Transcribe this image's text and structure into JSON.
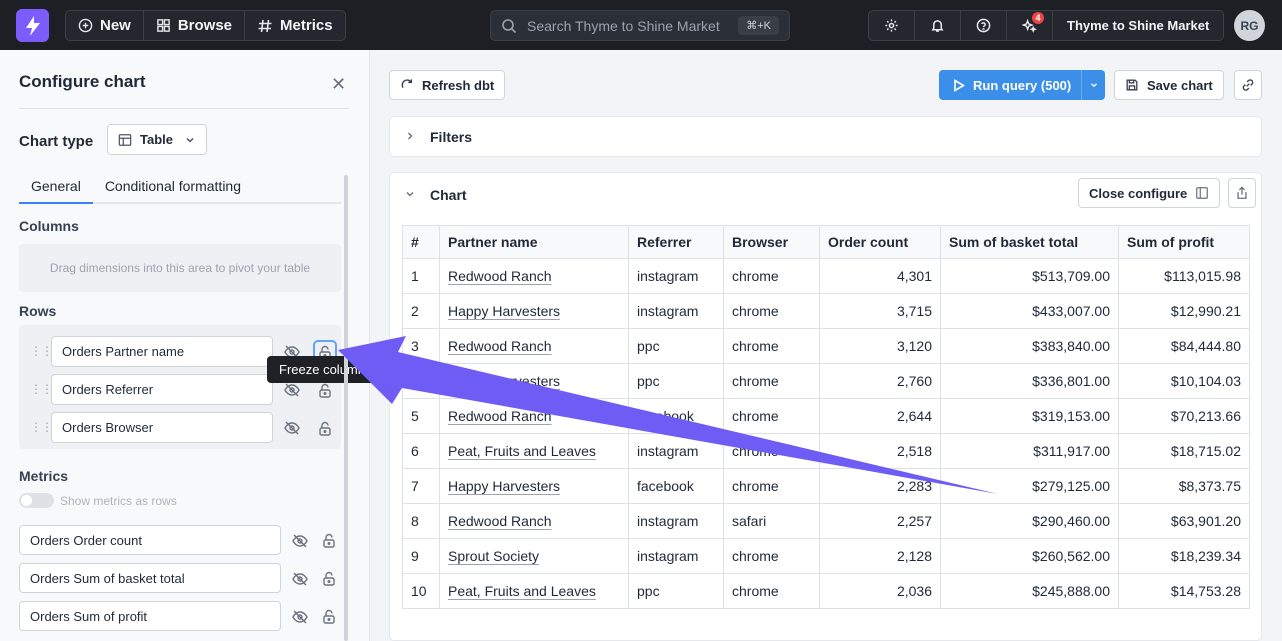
{
  "topbar": {
    "new_label": "New",
    "browse_label": "Browse",
    "metrics_label": "Metrics",
    "search_placeholder": "Search Thyme to Shine Market",
    "search_shortcut": "⌘+K",
    "notification_badge": "4",
    "org_name": "Thyme to Shine Market",
    "avatar_initials": "RG"
  },
  "config": {
    "title": "Configure chart",
    "chart_type_label": "Chart type",
    "chart_type_value": "Table",
    "tabs": [
      "General",
      "Conditional formatting"
    ],
    "columns_title": "Columns",
    "columns_placeholder": "Drag dimensions into this area to pivot your table",
    "rows_title": "Rows",
    "rows": [
      "Orders Partner name",
      "Orders Referrer",
      "Orders Browser"
    ],
    "tooltip": "Freeze column",
    "metrics_title": "Metrics",
    "metrics_toggle_label": "Show metrics as rows",
    "metrics": [
      "Orders Order count",
      "Orders Sum of basket total",
      "Orders Sum of profit"
    ]
  },
  "main": {
    "refresh_label": "Refresh dbt",
    "run_label": "Run query (500)",
    "save_label": "Save chart",
    "filters_title": "Filters",
    "chart_title": "Chart",
    "close_configure_label": "Close configure"
  },
  "table": {
    "headers": [
      "#",
      "Partner name",
      "Referrer",
      "Browser",
      "Order count",
      "Sum of basket total",
      "Sum of profit"
    ],
    "rows": [
      [
        "1",
        "Redwood Ranch",
        "instagram",
        "chrome",
        "4,301",
        "$513,709.00",
        "$113,015.98"
      ],
      [
        "2",
        "Happy Harvesters",
        "instagram",
        "chrome",
        "3,715",
        "$433,007.00",
        "$12,990.21"
      ],
      [
        "3",
        "Redwood Ranch",
        "ppc",
        "chrome",
        "3,120",
        "$383,840.00",
        "$84,444.80"
      ],
      [
        "4",
        "Happy Harvesters",
        "ppc",
        "chrome",
        "2,760",
        "$336,801.00",
        "$10,104.03"
      ],
      [
        "5",
        "Redwood Ranch",
        "facebook",
        "chrome",
        "2,644",
        "$319,153.00",
        "$70,213.66"
      ],
      [
        "6",
        "Peat, Fruits and Leaves",
        "instagram",
        "chrome",
        "2,518",
        "$311,917.00",
        "$18,715.02"
      ],
      [
        "7",
        "Happy Harvesters",
        "facebook",
        "chrome",
        "2,283",
        "$279,125.00",
        "$8,373.75"
      ],
      [
        "8",
        "Redwood Ranch",
        "instagram",
        "safari",
        "2,257",
        "$290,460.00",
        "$63,901.20"
      ],
      [
        "9",
        "Sprout Society",
        "instagram",
        "chrome",
        "2,128",
        "$260,562.00",
        "$18,239.34"
      ],
      [
        "10",
        "Peat, Fruits and Leaves",
        "ppc",
        "chrome",
        "2,036",
        "$245,888.00",
        "$14,753.28"
      ]
    ]
  },
  "colors": {
    "brand": "#7c5cfc",
    "run_button": "#3b8fe9",
    "annotation_arrow": "#6f5cf5"
  }
}
